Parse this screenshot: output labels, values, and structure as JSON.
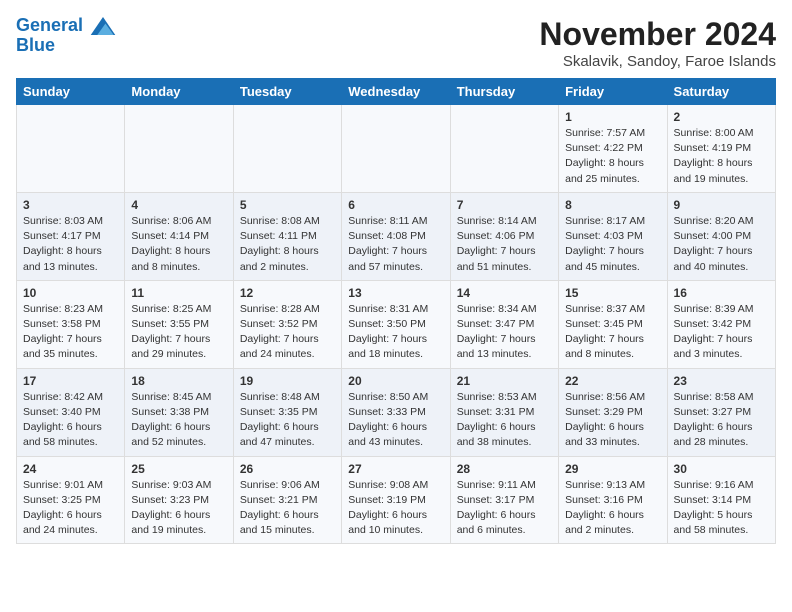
{
  "logo": {
    "line1": "General",
    "line2": "Blue"
  },
  "title": "November 2024",
  "subtitle": "Skalavik, Sandoy, Faroe Islands",
  "headers": [
    "Sunday",
    "Monday",
    "Tuesday",
    "Wednesday",
    "Thursday",
    "Friday",
    "Saturday"
  ],
  "weeks": [
    [
      {
        "day": "",
        "info": ""
      },
      {
        "day": "",
        "info": ""
      },
      {
        "day": "",
        "info": ""
      },
      {
        "day": "",
        "info": ""
      },
      {
        "day": "",
        "info": ""
      },
      {
        "day": "1",
        "info": "Sunrise: 7:57 AM\nSunset: 4:22 PM\nDaylight: 8 hours\nand 25 minutes."
      },
      {
        "day": "2",
        "info": "Sunrise: 8:00 AM\nSunset: 4:19 PM\nDaylight: 8 hours\nand 19 minutes."
      }
    ],
    [
      {
        "day": "3",
        "info": "Sunrise: 8:03 AM\nSunset: 4:17 PM\nDaylight: 8 hours\nand 13 minutes."
      },
      {
        "day": "4",
        "info": "Sunrise: 8:06 AM\nSunset: 4:14 PM\nDaylight: 8 hours\nand 8 minutes."
      },
      {
        "day": "5",
        "info": "Sunrise: 8:08 AM\nSunset: 4:11 PM\nDaylight: 8 hours\nand 2 minutes."
      },
      {
        "day": "6",
        "info": "Sunrise: 8:11 AM\nSunset: 4:08 PM\nDaylight: 7 hours\nand 57 minutes."
      },
      {
        "day": "7",
        "info": "Sunrise: 8:14 AM\nSunset: 4:06 PM\nDaylight: 7 hours\nand 51 minutes."
      },
      {
        "day": "8",
        "info": "Sunrise: 8:17 AM\nSunset: 4:03 PM\nDaylight: 7 hours\nand 45 minutes."
      },
      {
        "day": "9",
        "info": "Sunrise: 8:20 AM\nSunset: 4:00 PM\nDaylight: 7 hours\nand 40 minutes."
      }
    ],
    [
      {
        "day": "10",
        "info": "Sunrise: 8:23 AM\nSunset: 3:58 PM\nDaylight: 7 hours\nand 35 minutes."
      },
      {
        "day": "11",
        "info": "Sunrise: 8:25 AM\nSunset: 3:55 PM\nDaylight: 7 hours\nand 29 minutes."
      },
      {
        "day": "12",
        "info": "Sunrise: 8:28 AM\nSunset: 3:52 PM\nDaylight: 7 hours\nand 24 minutes."
      },
      {
        "day": "13",
        "info": "Sunrise: 8:31 AM\nSunset: 3:50 PM\nDaylight: 7 hours\nand 18 minutes."
      },
      {
        "day": "14",
        "info": "Sunrise: 8:34 AM\nSunset: 3:47 PM\nDaylight: 7 hours\nand 13 minutes."
      },
      {
        "day": "15",
        "info": "Sunrise: 8:37 AM\nSunset: 3:45 PM\nDaylight: 7 hours\nand 8 minutes."
      },
      {
        "day": "16",
        "info": "Sunrise: 8:39 AM\nSunset: 3:42 PM\nDaylight: 7 hours\nand 3 minutes."
      }
    ],
    [
      {
        "day": "17",
        "info": "Sunrise: 8:42 AM\nSunset: 3:40 PM\nDaylight: 6 hours\nand 58 minutes."
      },
      {
        "day": "18",
        "info": "Sunrise: 8:45 AM\nSunset: 3:38 PM\nDaylight: 6 hours\nand 52 minutes."
      },
      {
        "day": "19",
        "info": "Sunrise: 8:48 AM\nSunset: 3:35 PM\nDaylight: 6 hours\nand 47 minutes."
      },
      {
        "day": "20",
        "info": "Sunrise: 8:50 AM\nSunset: 3:33 PM\nDaylight: 6 hours\nand 43 minutes."
      },
      {
        "day": "21",
        "info": "Sunrise: 8:53 AM\nSunset: 3:31 PM\nDaylight: 6 hours\nand 38 minutes."
      },
      {
        "day": "22",
        "info": "Sunrise: 8:56 AM\nSunset: 3:29 PM\nDaylight: 6 hours\nand 33 minutes."
      },
      {
        "day": "23",
        "info": "Sunrise: 8:58 AM\nSunset: 3:27 PM\nDaylight: 6 hours\nand 28 minutes."
      }
    ],
    [
      {
        "day": "24",
        "info": "Sunrise: 9:01 AM\nSunset: 3:25 PM\nDaylight: 6 hours\nand 24 minutes."
      },
      {
        "day": "25",
        "info": "Sunrise: 9:03 AM\nSunset: 3:23 PM\nDaylight: 6 hours\nand 19 minutes."
      },
      {
        "day": "26",
        "info": "Sunrise: 9:06 AM\nSunset: 3:21 PM\nDaylight: 6 hours\nand 15 minutes."
      },
      {
        "day": "27",
        "info": "Sunrise: 9:08 AM\nSunset: 3:19 PM\nDaylight: 6 hours\nand 10 minutes."
      },
      {
        "day": "28",
        "info": "Sunrise: 9:11 AM\nSunset: 3:17 PM\nDaylight: 6 hours\nand 6 minutes."
      },
      {
        "day": "29",
        "info": "Sunrise: 9:13 AM\nSunset: 3:16 PM\nDaylight: 6 hours\nand 2 minutes."
      },
      {
        "day": "30",
        "info": "Sunrise: 9:16 AM\nSunset: 3:14 PM\nDaylight: 5 hours\nand 58 minutes."
      }
    ]
  ]
}
